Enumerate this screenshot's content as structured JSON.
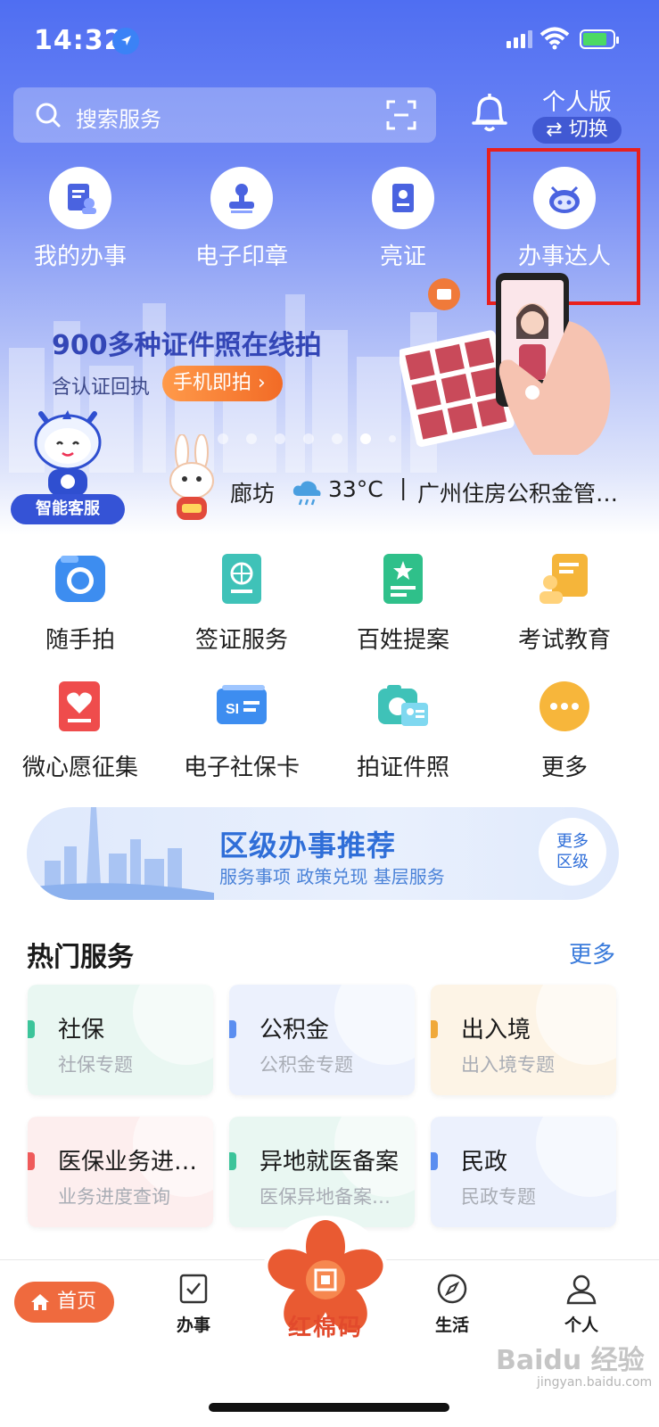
{
  "status_bar": {
    "time": "14:32"
  },
  "search": {
    "placeholder": "搜索服务"
  },
  "header": {
    "mode_title": "个人版",
    "switch_label": "⇄ 切换"
  },
  "quick_actions": [
    {
      "label": "我的办事",
      "icon": "document-user-icon"
    },
    {
      "label": "电子印章",
      "icon": "stamp-icon"
    },
    {
      "label": "亮证",
      "icon": "id-card-icon"
    },
    {
      "label": "办事达人",
      "icon": "robot-icon"
    }
  ],
  "banner": {
    "title": "900多种证件照在线拍",
    "subtitle": "含认证回执",
    "button": "手机即拍 ›",
    "page_count": 8,
    "active_page": 6
  },
  "assistant": {
    "label": "智能客服"
  },
  "ticker": {
    "city": "廊坊",
    "temperature": "33°C",
    "separator": "|",
    "news": "广州住房公积金管…"
  },
  "services": [
    {
      "label": "随手拍",
      "icon": "camera-icon"
    },
    {
      "label": "签证服务",
      "icon": "passport-icon"
    },
    {
      "label": "百姓提案",
      "icon": "proposal-icon"
    },
    {
      "label": "考试教育",
      "icon": "exam-icon"
    },
    {
      "label": "微心愿征集",
      "icon": "heart-wish-icon"
    },
    {
      "label": "电子社保卡",
      "icon": "social-security-card-icon"
    },
    {
      "label": "拍证件照",
      "icon": "id-photo-icon"
    },
    {
      "label": "更多",
      "icon": "more-icon"
    }
  ],
  "district": {
    "title": "区级办事推荐",
    "tags": "服务事项  政策兑现  基层服务",
    "more": "更多\n区级",
    "more_line1": "更多",
    "more_line2": "区级"
  },
  "hot": {
    "title": "热门服务",
    "more": "更多",
    "cards": [
      {
        "title": "社保",
        "subtitle": "社保专题",
        "accent": "#3cc49a",
        "bg": "#e9f7f2"
      },
      {
        "title": "公积金",
        "subtitle": "公积金专题",
        "accent": "#5b8ef0",
        "bg": "#ecf1fd"
      },
      {
        "title": "出入境",
        "subtitle": "出入境专题",
        "accent": "#f0a93a",
        "bg": "#fdf4e6"
      },
      {
        "title": "医保业务进…",
        "subtitle": "业务进度查询",
        "accent": "#ef5a5a",
        "bg": "#fdeeee"
      },
      {
        "title": "异地就医备案",
        "subtitle": "医保异地备案…",
        "accent": "#3cc49a",
        "bg": "#e9f7f2"
      },
      {
        "title": "民政",
        "subtitle": "民政专题",
        "accent": "#5b8ef0",
        "bg": "#ecf1fd"
      }
    ]
  },
  "tabbar": {
    "home": "首页",
    "affairs": "办事",
    "center": "红棉码",
    "life": "生活",
    "personal": "个人"
  },
  "watermark": {
    "main": "Baidu 经验",
    "sub": "jingyan.baidu.com"
  },
  "colors": {
    "header_blue": "#4f6ef2",
    "highlight_red": "#e8201e",
    "accent_orange": "#ef6a3e",
    "link_blue": "#3a7bdb"
  }
}
